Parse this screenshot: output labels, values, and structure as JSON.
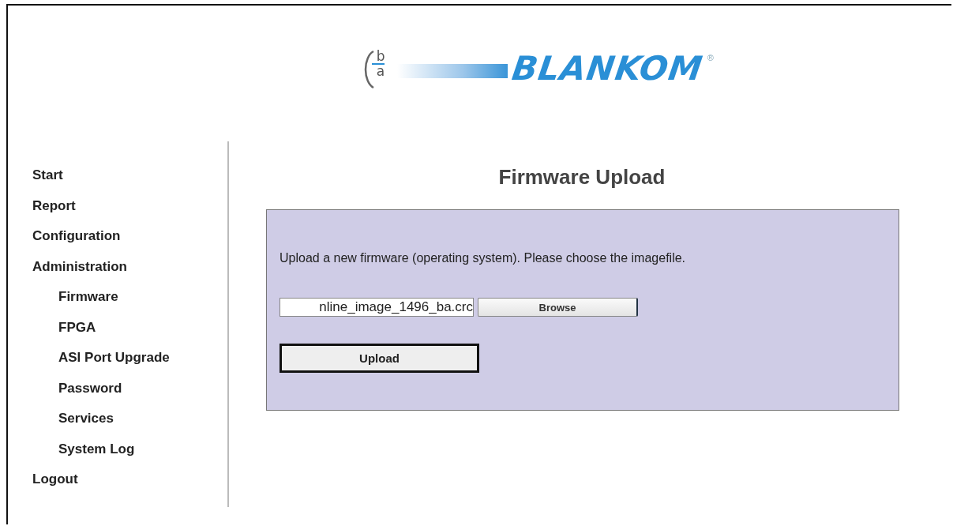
{
  "logo": {
    "mark_top": "b",
    "mark_bottom": "a",
    "wordmark": "BLANKOM",
    "registered": "®"
  },
  "sidebar": {
    "items": [
      {
        "label": "Start"
      },
      {
        "label": "Report"
      },
      {
        "label": "Configuration"
      },
      {
        "label": "Administration",
        "children": [
          {
            "label": "Firmware"
          },
          {
            "label": "FPGA"
          },
          {
            "label": "ASI Port Upgrade"
          },
          {
            "label": "Password"
          },
          {
            "label": "Services"
          },
          {
            "label": "System Log"
          }
        ]
      },
      {
        "label": "Logout"
      }
    ]
  },
  "heading": "Firmware Upload",
  "panel": {
    "instruction": "Upload a new firmware (operating system). Please choose the imagefile.",
    "file_field": {
      "value": "nline_image_1496_ba.crc"
    },
    "browse_button": "Browse",
    "upload_button": "Upload"
  }
}
